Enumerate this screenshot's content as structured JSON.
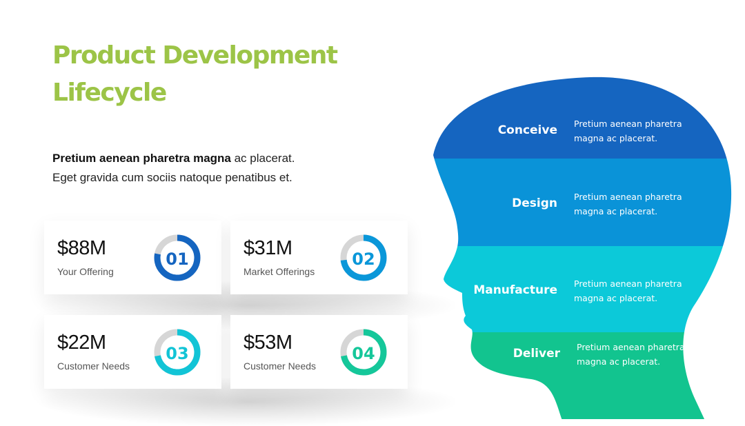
{
  "title": "Product Development Lifecycle",
  "intro": {
    "bold": "Pretium aenean pharetra magna",
    "rest": " ac placerat. Eget gravida cum sociis natoque penatibus et."
  },
  "cards": [
    {
      "amount": "$88M",
      "label": "Your Offering",
      "number": "01",
      "color": "#1565c0",
      "progress": 0.78
    },
    {
      "amount": "$31M",
      "label": "Market Offerings",
      "number": "02",
      "color": "#0a97d9",
      "progress": 0.73
    },
    {
      "amount": "$22M",
      "label": "Customer Needs",
      "number": "03",
      "color": "#12c4d6",
      "progress": 0.72
    },
    {
      "amount": "$53M",
      "label": "Customer Needs",
      "number": "04",
      "color": "#15c79a",
      "progress": 0.72
    }
  ],
  "ring_track_color": "#d6d6d6",
  "stages": [
    {
      "label": "Conceive",
      "text_line1": "Pretium aenean pharetra",
      "text_line2": "magna ac placerat.",
      "color": "#1565c0"
    },
    {
      "label": "Design",
      "text_line1": "Pretium aenean pharetra",
      "text_line2": "magna ac placerat.",
      "color": "#0a93d8"
    },
    {
      "label": "Manufacture",
      "text_line1": "Pretium aenean pharetra",
      "text_line2": "magna ac placerat.",
      "color": "#0cc9d9"
    },
    {
      "label": "Deliver",
      "text_line1": "Pretium aenean pharetra",
      "text_line2": "magna ac placerat.",
      "color": "#12c48f"
    }
  ],
  "title_color": "#9cc447"
}
